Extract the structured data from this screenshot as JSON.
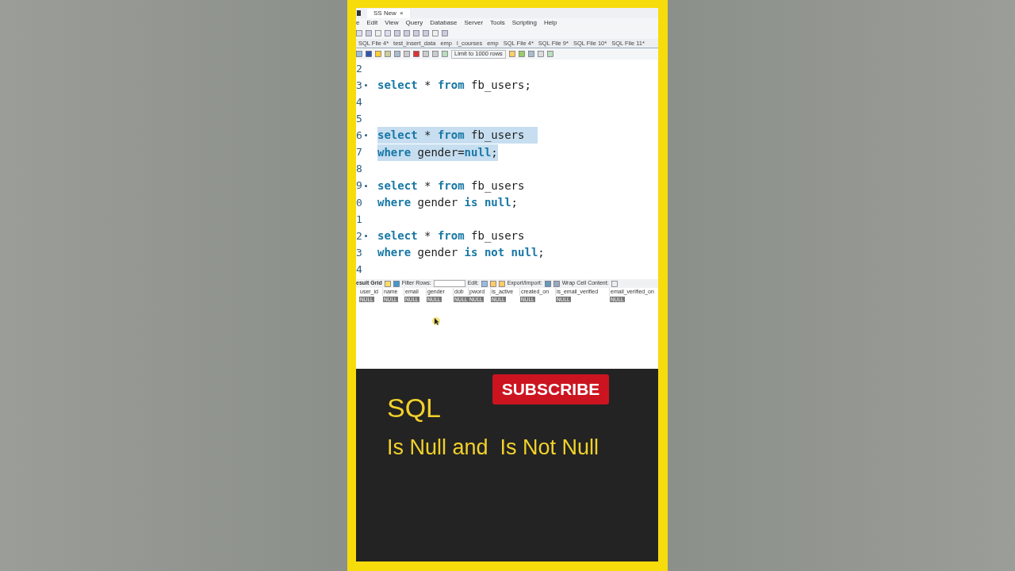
{
  "app": {
    "tab_title": "SS New",
    "tab_close": "×",
    "menu": [
      "e",
      "Edit",
      "View",
      "Query",
      "Database",
      "Server",
      "Tools",
      "Scripting",
      "Help"
    ],
    "file_tabs": [
      {
        "label": "SQL File 4*",
        "selected": false
      },
      {
        "label": "test_insert_data",
        "selected": false
      },
      {
        "label": "emp",
        "selected": false
      },
      {
        "label": "l_courses",
        "selected": false
      },
      {
        "label": "emp",
        "selected": false
      },
      {
        "label": "SQL File 4*",
        "selected": false
      },
      {
        "label": "SQL File 9*",
        "selected": false
      },
      {
        "label": "SQL File 10*",
        "selected": false
      },
      {
        "label": "SQL File 11*",
        "selected": false
      }
    ],
    "limit_dropdown": "Limit to 1000 rows",
    "editor_lines": [
      {
        "number": "2",
        "fold": false,
        "selected": false
      },
      {
        "number": "3",
        "fold": true,
        "selected": false,
        "tokens": [
          {
            "kind": "keyword",
            "text": "select"
          },
          {
            "kind": "plain",
            "text": " * "
          },
          {
            "kind": "keyword",
            "text": "from"
          },
          {
            "kind": "plain",
            "text": " fb_users;"
          }
        ]
      },
      {
        "number": "4",
        "fold": false,
        "selected": false
      },
      {
        "number": "5",
        "fold": false,
        "selected": false
      },
      {
        "number": "6",
        "fold": true,
        "selected": true,
        "tokens": [
          {
            "kind": "keyword",
            "text": "select"
          },
          {
            "kind": "plain",
            "text": " * "
          },
          {
            "kind": "keyword",
            "text": "from"
          },
          {
            "kind": "plain",
            "text": " fb_users  "
          }
        ]
      },
      {
        "number": "7",
        "fold": false,
        "selected": true,
        "tokens": [
          {
            "kind": "keyword",
            "text": "where"
          },
          {
            "kind": "plain",
            "text": " gender="
          },
          {
            "kind": "keyword",
            "text": "null"
          },
          {
            "kind": "plain",
            "text": ";"
          }
        ]
      },
      {
        "number": "8",
        "fold": false,
        "selected": false
      },
      {
        "number": "9",
        "fold": true,
        "selected": false,
        "tokens": [
          {
            "kind": "keyword",
            "text": "select"
          },
          {
            "kind": "plain",
            "text": " * "
          },
          {
            "kind": "keyword",
            "text": "from"
          },
          {
            "kind": "plain",
            "text": " fb_users"
          }
        ]
      },
      {
        "number": "0",
        "fold": false,
        "selected": false,
        "tokens": [
          {
            "kind": "keyword",
            "text": "where"
          },
          {
            "kind": "plain",
            "text": " gender "
          },
          {
            "kind": "keyword",
            "text": "is null"
          },
          {
            "kind": "plain",
            "text": ";"
          }
        ]
      },
      {
        "number": "1",
        "fold": false,
        "selected": false
      },
      {
        "number": "2",
        "fold": true,
        "selected": false,
        "tokens": [
          {
            "kind": "keyword",
            "text": "select"
          },
          {
            "kind": "plain",
            "text": " * "
          },
          {
            "kind": "keyword",
            "text": "from"
          },
          {
            "kind": "plain",
            "text": " fb_users"
          }
        ]
      },
      {
        "number": "3",
        "fold": false,
        "selected": false,
        "tokens": [
          {
            "kind": "keyword",
            "text": "where"
          },
          {
            "kind": "plain",
            "text": " gender "
          },
          {
            "kind": "keyword",
            "text": "is not null"
          },
          {
            "kind": "plain",
            "text": ";"
          }
        ]
      },
      {
        "number": "4",
        "fold": false,
        "selected": false
      }
    ],
    "result_toolbar": {
      "grid_label": "esult Grid",
      "filter_label": "Filter Rows:",
      "edit_label": "Edit:",
      "export_label": "Export/Import:",
      "wrap_label": "Wrap Cell Content:"
    },
    "result_columns": [
      "user_id",
      "name",
      "email",
      "gender",
      "dob",
      "pword",
      "is_active",
      "created_on",
      "is_email_verified",
      "email_verified_on"
    ],
    "result_row": [
      "NULL",
      "NULL",
      "NULL",
      "NULL",
      "NULL",
      "NULL",
      "NULL",
      "NULL",
      "NULL",
      "NULL"
    ]
  },
  "overlay": {
    "subscribe": "SUBSCRIBE",
    "title": "SQL",
    "subtitle": "Is Null and  Is Not Null"
  }
}
